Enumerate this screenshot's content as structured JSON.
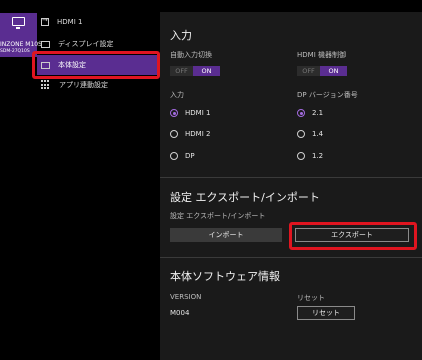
{
  "sidebar": {
    "device_model": "INZONE M10S",
    "device_sub": "SDM-27Q10S",
    "items": [
      {
        "label": "HDMI 1",
        "icon": "input-icon"
      },
      {
        "label": "ディスプレイ設定",
        "icon": "display-icon"
      },
      {
        "label": "本体設定",
        "icon": "monitor-icon"
      },
      {
        "label": "アプリ連動設定",
        "icon": "grid-icon"
      }
    ]
  },
  "input": {
    "title": "入力",
    "auto_switch_label": "自動入力切換",
    "hdmi_control_label": "HDMI 機器制御",
    "off": "OFF",
    "on": "ON",
    "input_label": "入力",
    "dp_version_label": "DP バージョン番号",
    "inputs": [
      "HDMI 1",
      "HDMI 2",
      "DP"
    ],
    "dp_versions": [
      "2.1",
      "1.4",
      "1.2"
    ]
  },
  "export": {
    "title": "設定 エクスポート/インポート",
    "sub_label": "設定 エクスポート/インポート",
    "import_label": "インポート",
    "export_label": "エクスポート"
  },
  "software": {
    "title": "本体ソフトウェア情報",
    "version_label": "VERSION",
    "version_value": "M004",
    "reset_label": "リセット",
    "reset_button": "リセット"
  },
  "colors": {
    "accent": "#5a2d91",
    "highlight": "#e01520"
  }
}
